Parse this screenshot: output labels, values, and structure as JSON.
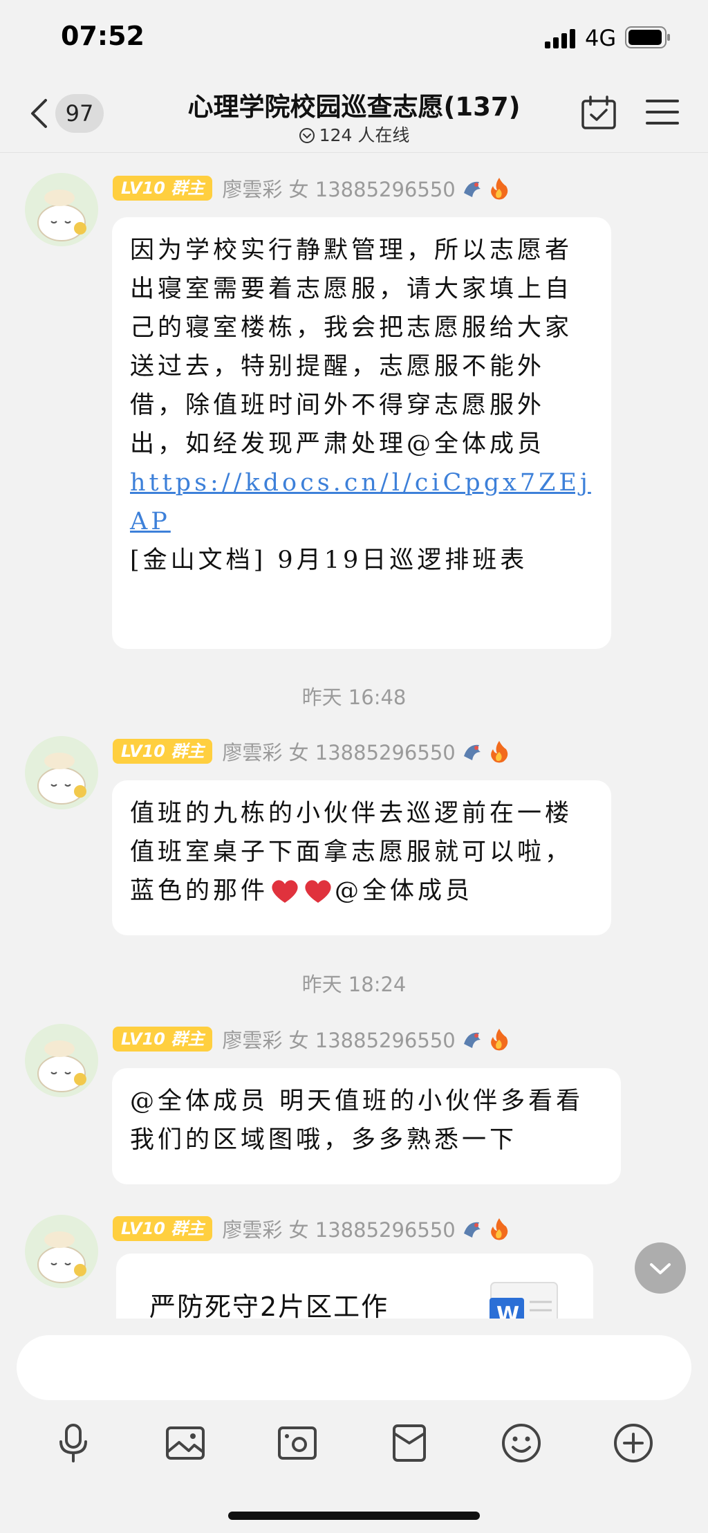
{
  "status_bar": {
    "time": "07:52",
    "network": "4G"
  },
  "nav": {
    "back_count": "97",
    "title": "心理学院校园巡查志愿(137)",
    "online": "124 人在线"
  },
  "sender": {
    "badge": "LV10 群主",
    "name": "廖雲彩 女 13885296550"
  },
  "messages": [
    {
      "text": "因为学校实行静默管理，所以志愿者出寝室需要着志愿服，请大家填上自己的寝室楼栋，我会把志愿服给大家送过去，特别提醒，志愿服不能外借，除值班时间外不得穿志愿服外出，如经发现严肃处理@全体成员",
      "link": "https://kdocs.cn/l/ciCpgx7ZEjAP",
      "doc": "[金山文档] 9月19日巡逻排班表"
    },
    {
      "time": "昨天 16:48"
    },
    {
      "text": "值班的九栋的小伙伴去巡逻前在一楼值班室桌子下面拿志愿服就可以啦，蓝色的那件",
      "mention": "@全体成员"
    },
    {
      "time": "昨天 18:24"
    },
    {
      "text": "@全体成员  明天值班的小伙伴多看看我们的区域图哦，多多熟悉一下"
    },
    {
      "file_name": "严防死守2片区工作"
    }
  ],
  "icons": [
    "back-chevron-icon",
    "calendar-check-icon",
    "menu-icon",
    "microphone-icon",
    "image-icon",
    "camera-icon",
    "red-packet-icon",
    "emoji-icon",
    "plus-icon"
  ],
  "colors": {
    "badge": "#ffcf3f",
    "link": "#3d80d9",
    "background": "#f2f2f2"
  }
}
